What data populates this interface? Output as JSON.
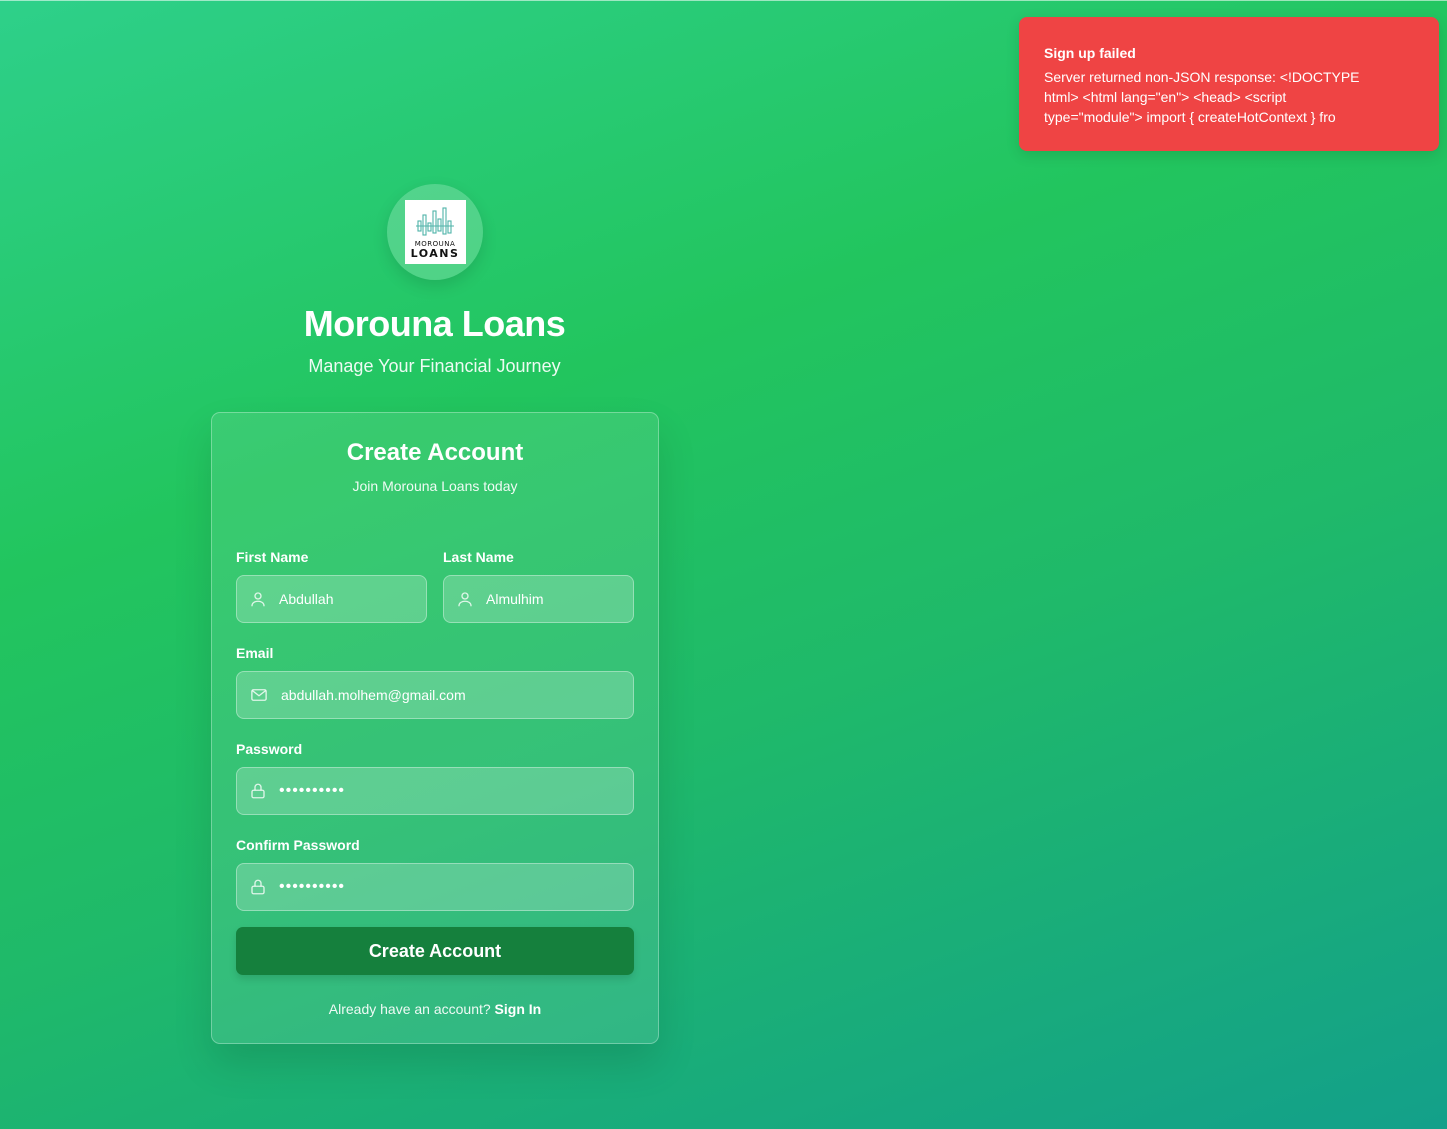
{
  "toast": {
    "title": "Sign up failed",
    "message": "Server returned non-JSON response: <!DOCTYPE html> <html lang=\"en\"> <head> <script type=\"module\"> import { createHotContext } fro",
    "color": "#ef4444"
  },
  "brand": {
    "logo_line1": "MOROUNA",
    "logo_line2": "LOANS",
    "title": "Morouna Loans",
    "subtitle": "Manage Your Financial Journey"
  },
  "form": {
    "title": "Create Account",
    "subtitle": "Join Morouna Loans today",
    "first_name": {
      "label": "First Name",
      "value": "Abdullah",
      "icon": "user-icon"
    },
    "last_name": {
      "label": "Last Name",
      "value": "Almulhim",
      "icon": "user-icon"
    },
    "email": {
      "label": "Email",
      "value": "abdullah.molhem@gmail.com",
      "icon": "mail-icon"
    },
    "password": {
      "label": "Password",
      "value": "••••••••••",
      "icon": "lock-icon"
    },
    "confirm_password": {
      "label": "Confirm Password",
      "value": "••••••••••",
      "icon": "lock-icon"
    },
    "submit_label": "Create Account",
    "footer_text": "Already have an account?",
    "signin_label": "Sign In"
  },
  "colors": {
    "button": "#15803d",
    "toast": "#ef4444"
  }
}
